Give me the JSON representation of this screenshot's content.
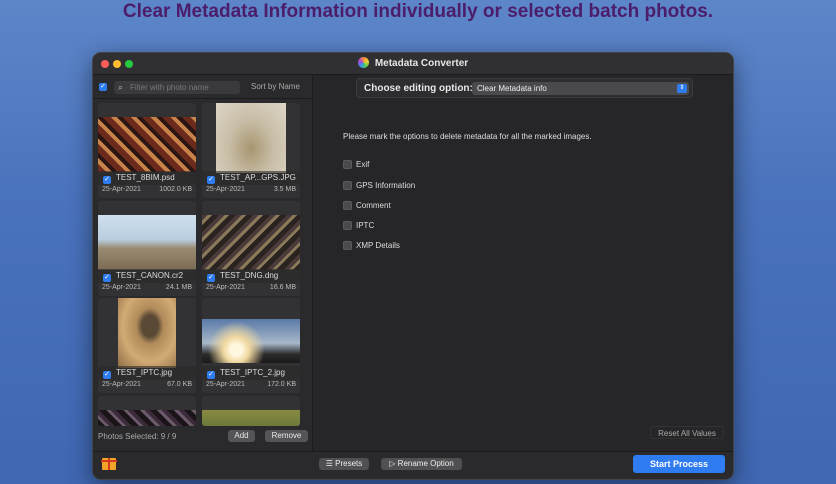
{
  "headline": "Clear Metadata Information individually or selected batch photos.",
  "window": {
    "title": "Metadata Converter"
  },
  "left_panel": {
    "select_all_checked": true,
    "search_placeholder": "Filter with photo name",
    "sort_label": "Sort by Name",
    "photos": [
      {
        "name": "TEST_8BIM.psd",
        "date": "25-Apr-2021",
        "size": "1002.0 KB",
        "checked": true
      },
      {
        "name": "TEST_AP...GPS.JPG",
        "date": "25-Apr-2021",
        "size": "3.5 MB",
        "checked": true
      },
      {
        "name": "TEST_CANON.cr2",
        "date": "25-Apr-2021",
        "size": "24.1 MB",
        "checked": true
      },
      {
        "name": "TEST_DNG.dng",
        "date": "25-Apr-2021",
        "size": "16.6 MB",
        "checked": true
      },
      {
        "name": "TEST_IPTC.jpg",
        "date": "25-Apr-2021",
        "size": "67.0 KB",
        "checked": true
      },
      {
        "name": "TEST_IPTC_2.jpg",
        "date": "25-Apr-2021",
        "size": "172.0 KB",
        "checked": true
      }
    ],
    "photos_selected": "Photos Selected: 9 / 9",
    "add_label": "Add",
    "remove_label": "Remove"
  },
  "right_panel": {
    "option_label": "Choose editing option:",
    "option_value": "Clear Metadata info",
    "instruction": "Please mark the options to delete metadata for all the marked images.",
    "options": [
      {
        "label": "Exif",
        "checked": false
      },
      {
        "label": "GPS Information",
        "checked": false
      },
      {
        "label": "Comment",
        "checked": false
      },
      {
        "label": "IPTC",
        "checked": false
      },
      {
        "label": "XMP Details",
        "checked": false
      }
    ],
    "reset_label": "Reset All Values"
  },
  "bottom_bar": {
    "presets_label": "Presets",
    "rename_label": "Rename Option",
    "start_label": "Start Process"
  },
  "colors": {
    "accent": "#2f7cf0",
    "headline": "#4b1d6b",
    "window_bg": "#262628"
  }
}
